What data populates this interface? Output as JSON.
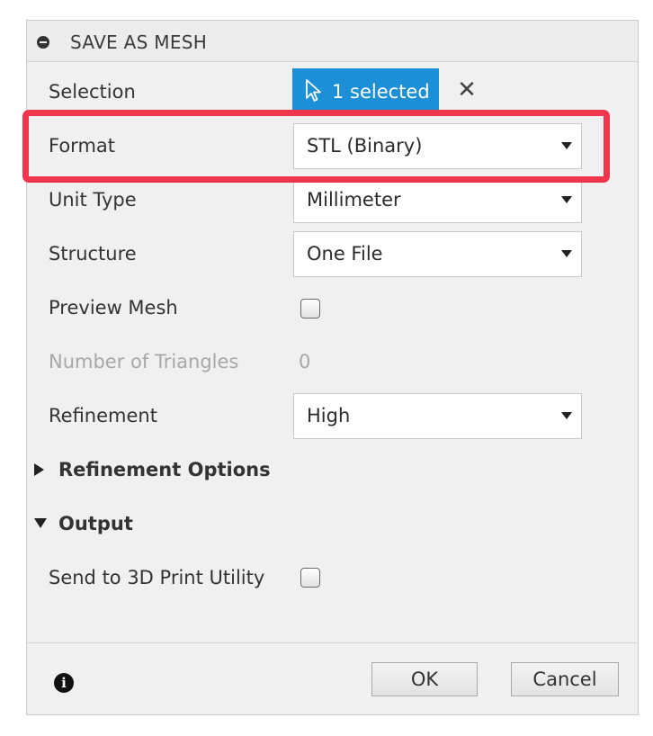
{
  "dialog": {
    "title": "SAVE AS MESH",
    "title_icon": "collapse-minus-icon"
  },
  "selection": {
    "label": "Selection",
    "button_label": "1 selected",
    "button_color": "#1d8fd6",
    "icon": "cursor-arrow-icon",
    "clear_icon_glyph": "✕"
  },
  "format": {
    "label": "Format",
    "value": "STL (Binary)"
  },
  "unit_type": {
    "label": "Unit Type",
    "value": "Millimeter"
  },
  "structure": {
    "label": "Structure",
    "value": "One File"
  },
  "preview_mesh": {
    "label": "Preview Mesh",
    "checked": false
  },
  "triangles": {
    "label": "Number of Triangles",
    "value": "0"
  },
  "refinement": {
    "label": "Refinement",
    "value": "High"
  },
  "refinement_options": {
    "label": "Refinement Options",
    "expanded": false
  },
  "output": {
    "label": "Output",
    "expanded": true
  },
  "send_to_3d": {
    "label": "Send to 3D Print Utility",
    "checked": false
  },
  "footer": {
    "info_glyph": "i",
    "ok_label": "OK",
    "cancel_label": "Cancel"
  },
  "highlight": {
    "color": "#f0364d",
    "target": "format"
  }
}
